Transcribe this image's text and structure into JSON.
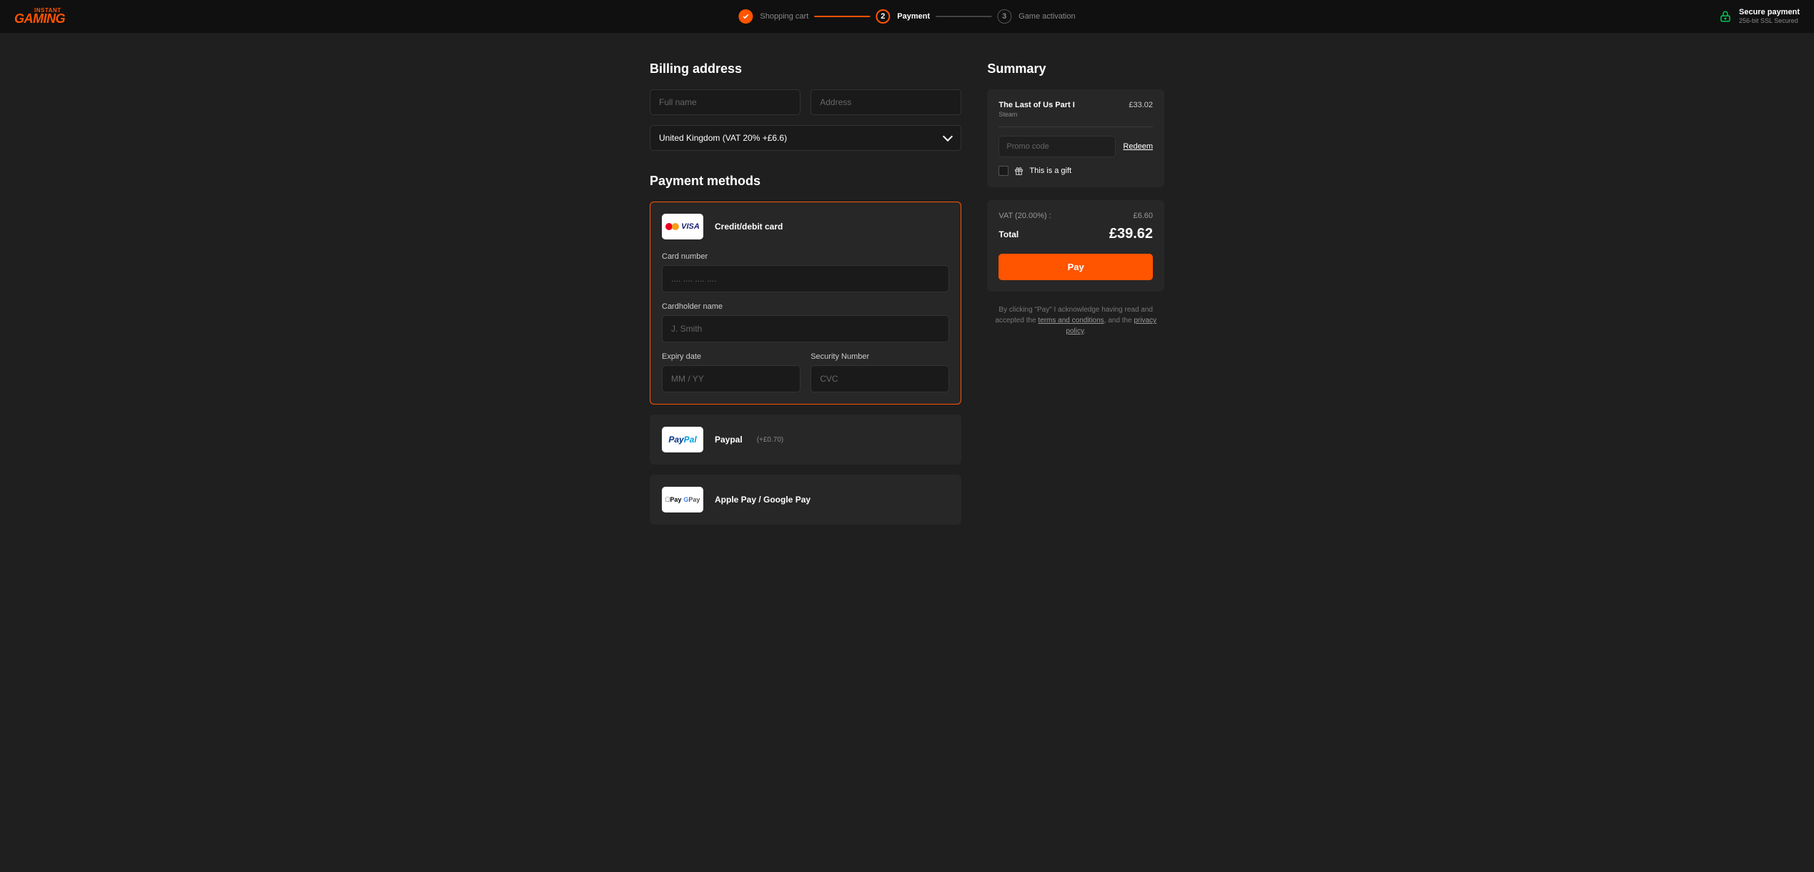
{
  "header": {
    "logo_top": "INSTANT",
    "logo_main": "GAMING",
    "secure_title": "Secure payment",
    "secure_sub": "256-bit SSL Secured"
  },
  "stepper": {
    "step1": "Shopping cart",
    "step2_num": "2",
    "step2": "Payment",
    "step3_num": "3",
    "step3": "Game activation"
  },
  "billing": {
    "title": "Billing address",
    "full_name_placeholder": "Full name",
    "address_placeholder": "Address",
    "country": "United Kingdom (VAT 20% +£6.6)"
  },
  "payment": {
    "title": "Payment methods",
    "card": {
      "name": "Credit/debit card",
      "card_number_label": "Card number",
      "card_number_placeholder": ".... .... .... ....",
      "cardholder_label": "Cardholder name",
      "cardholder_placeholder": "J. Smith",
      "expiry_label": "Expiry date",
      "expiry_placeholder": "MM / YY",
      "cvc_label": "Security Number",
      "cvc_placeholder": "CVC"
    },
    "paypal": {
      "name": "Paypal",
      "fee": "(+£0.70)"
    },
    "applepay": {
      "name": "Apple Pay / Google Pay"
    }
  },
  "summary": {
    "title": "Summary",
    "item_name": "The Last of Us Part I",
    "item_platform": "Steam",
    "item_price": "£33.02",
    "promo_placeholder": "Promo code",
    "redeem": "Redeem",
    "gift_label": "This is a gift",
    "vat_label": "VAT (20.00%) :",
    "vat_value": "£6.60",
    "total_label": "Total",
    "total_value": "£39.62",
    "pay_button": "Pay"
  },
  "disclaimer": {
    "pre": "By clicking \"Pay\" I acknowledge having read and accepted the ",
    "terms": "terms and conditions",
    "mid": ", and the ",
    "privacy": "privacy policy",
    "suffix": "."
  }
}
